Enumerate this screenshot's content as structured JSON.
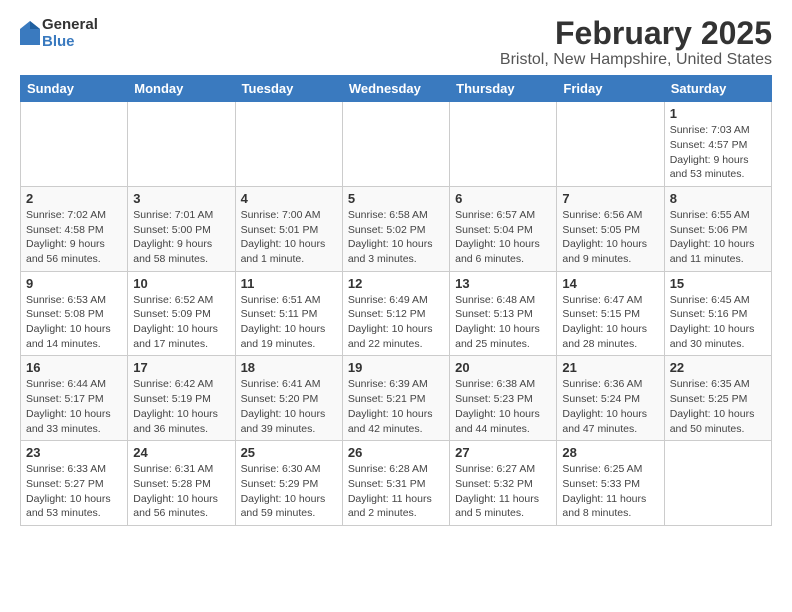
{
  "logo": {
    "general": "General",
    "blue": "Blue"
  },
  "title": "February 2025",
  "subtitle": "Bristol, New Hampshire, United States",
  "days_of_week": [
    "Sunday",
    "Monday",
    "Tuesday",
    "Wednesday",
    "Thursday",
    "Friday",
    "Saturday"
  ],
  "weeks": [
    [
      {
        "day": "",
        "info": ""
      },
      {
        "day": "",
        "info": ""
      },
      {
        "day": "",
        "info": ""
      },
      {
        "day": "",
        "info": ""
      },
      {
        "day": "",
        "info": ""
      },
      {
        "day": "",
        "info": ""
      },
      {
        "day": "1",
        "info": "Sunrise: 7:03 AM\nSunset: 4:57 PM\nDaylight: 9 hours and 53 minutes."
      }
    ],
    [
      {
        "day": "2",
        "info": "Sunrise: 7:02 AM\nSunset: 4:58 PM\nDaylight: 9 hours and 56 minutes."
      },
      {
        "day": "3",
        "info": "Sunrise: 7:01 AM\nSunset: 5:00 PM\nDaylight: 9 hours and 58 minutes."
      },
      {
        "day": "4",
        "info": "Sunrise: 7:00 AM\nSunset: 5:01 PM\nDaylight: 10 hours and 1 minute."
      },
      {
        "day": "5",
        "info": "Sunrise: 6:58 AM\nSunset: 5:02 PM\nDaylight: 10 hours and 3 minutes."
      },
      {
        "day": "6",
        "info": "Sunrise: 6:57 AM\nSunset: 5:04 PM\nDaylight: 10 hours and 6 minutes."
      },
      {
        "day": "7",
        "info": "Sunrise: 6:56 AM\nSunset: 5:05 PM\nDaylight: 10 hours and 9 minutes."
      },
      {
        "day": "8",
        "info": "Sunrise: 6:55 AM\nSunset: 5:06 PM\nDaylight: 10 hours and 11 minutes."
      }
    ],
    [
      {
        "day": "9",
        "info": "Sunrise: 6:53 AM\nSunset: 5:08 PM\nDaylight: 10 hours and 14 minutes."
      },
      {
        "day": "10",
        "info": "Sunrise: 6:52 AM\nSunset: 5:09 PM\nDaylight: 10 hours and 17 minutes."
      },
      {
        "day": "11",
        "info": "Sunrise: 6:51 AM\nSunset: 5:11 PM\nDaylight: 10 hours and 19 minutes."
      },
      {
        "day": "12",
        "info": "Sunrise: 6:49 AM\nSunset: 5:12 PM\nDaylight: 10 hours and 22 minutes."
      },
      {
        "day": "13",
        "info": "Sunrise: 6:48 AM\nSunset: 5:13 PM\nDaylight: 10 hours and 25 minutes."
      },
      {
        "day": "14",
        "info": "Sunrise: 6:47 AM\nSunset: 5:15 PM\nDaylight: 10 hours and 28 minutes."
      },
      {
        "day": "15",
        "info": "Sunrise: 6:45 AM\nSunset: 5:16 PM\nDaylight: 10 hours and 30 minutes."
      }
    ],
    [
      {
        "day": "16",
        "info": "Sunrise: 6:44 AM\nSunset: 5:17 PM\nDaylight: 10 hours and 33 minutes."
      },
      {
        "day": "17",
        "info": "Sunrise: 6:42 AM\nSunset: 5:19 PM\nDaylight: 10 hours and 36 minutes."
      },
      {
        "day": "18",
        "info": "Sunrise: 6:41 AM\nSunset: 5:20 PM\nDaylight: 10 hours and 39 minutes."
      },
      {
        "day": "19",
        "info": "Sunrise: 6:39 AM\nSunset: 5:21 PM\nDaylight: 10 hours and 42 minutes."
      },
      {
        "day": "20",
        "info": "Sunrise: 6:38 AM\nSunset: 5:23 PM\nDaylight: 10 hours and 44 minutes."
      },
      {
        "day": "21",
        "info": "Sunrise: 6:36 AM\nSunset: 5:24 PM\nDaylight: 10 hours and 47 minutes."
      },
      {
        "day": "22",
        "info": "Sunrise: 6:35 AM\nSunset: 5:25 PM\nDaylight: 10 hours and 50 minutes."
      }
    ],
    [
      {
        "day": "23",
        "info": "Sunrise: 6:33 AM\nSunset: 5:27 PM\nDaylight: 10 hours and 53 minutes."
      },
      {
        "day": "24",
        "info": "Sunrise: 6:31 AM\nSunset: 5:28 PM\nDaylight: 10 hours and 56 minutes."
      },
      {
        "day": "25",
        "info": "Sunrise: 6:30 AM\nSunset: 5:29 PM\nDaylight: 10 hours and 59 minutes."
      },
      {
        "day": "26",
        "info": "Sunrise: 6:28 AM\nSunset: 5:31 PM\nDaylight: 11 hours and 2 minutes."
      },
      {
        "day": "27",
        "info": "Sunrise: 6:27 AM\nSunset: 5:32 PM\nDaylight: 11 hours and 5 minutes."
      },
      {
        "day": "28",
        "info": "Sunrise: 6:25 AM\nSunset: 5:33 PM\nDaylight: 11 hours and 8 minutes."
      },
      {
        "day": "",
        "info": ""
      }
    ]
  ]
}
